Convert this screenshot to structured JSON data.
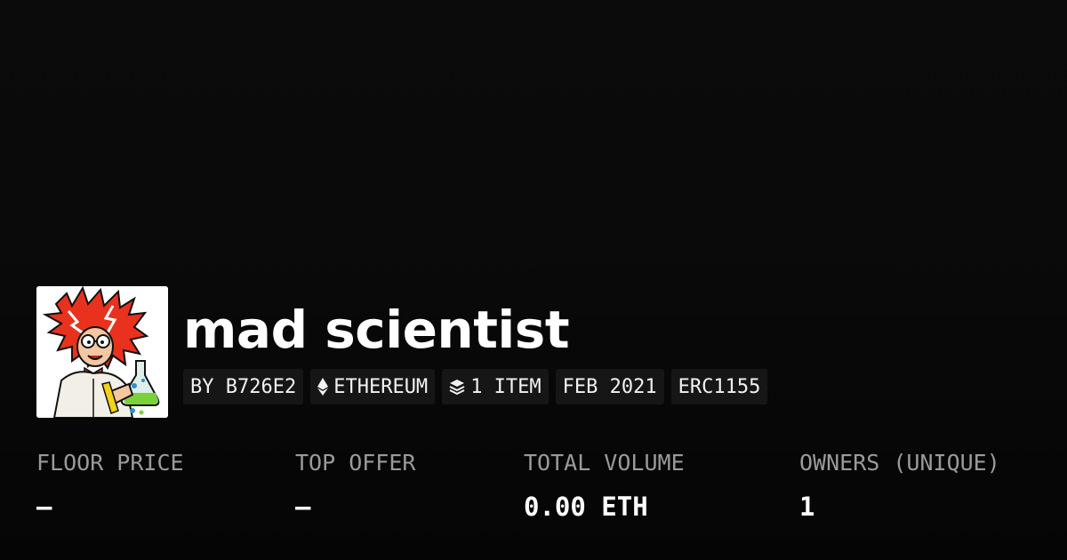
{
  "collection": {
    "title": "mad scientist",
    "avatar_icon": "mad-scientist-avatar"
  },
  "tags": {
    "creator": "BY B726E2",
    "chain": "ETHEREUM",
    "chain_icon": "ethereum-icon",
    "items": "1 ITEM",
    "items_icon": "layers-icon",
    "date": "FEB 2021",
    "standard": "ERC1155"
  },
  "stats": {
    "floor_price": {
      "label": "FLOOR PRICE",
      "value": "—"
    },
    "top_offer": {
      "label": "TOP OFFER",
      "value": "—"
    },
    "total_volume": {
      "label": "TOTAL VOLUME",
      "value": "0.00 ETH"
    },
    "owners": {
      "label": "OWNERS (UNIQUE)",
      "value": "1"
    }
  },
  "colors": {
    "background": "#0a0a0a",
    "tag_background": "#161616",
    "label": "#9a9a9a",
    "text": "#ffffff"
  }
}
